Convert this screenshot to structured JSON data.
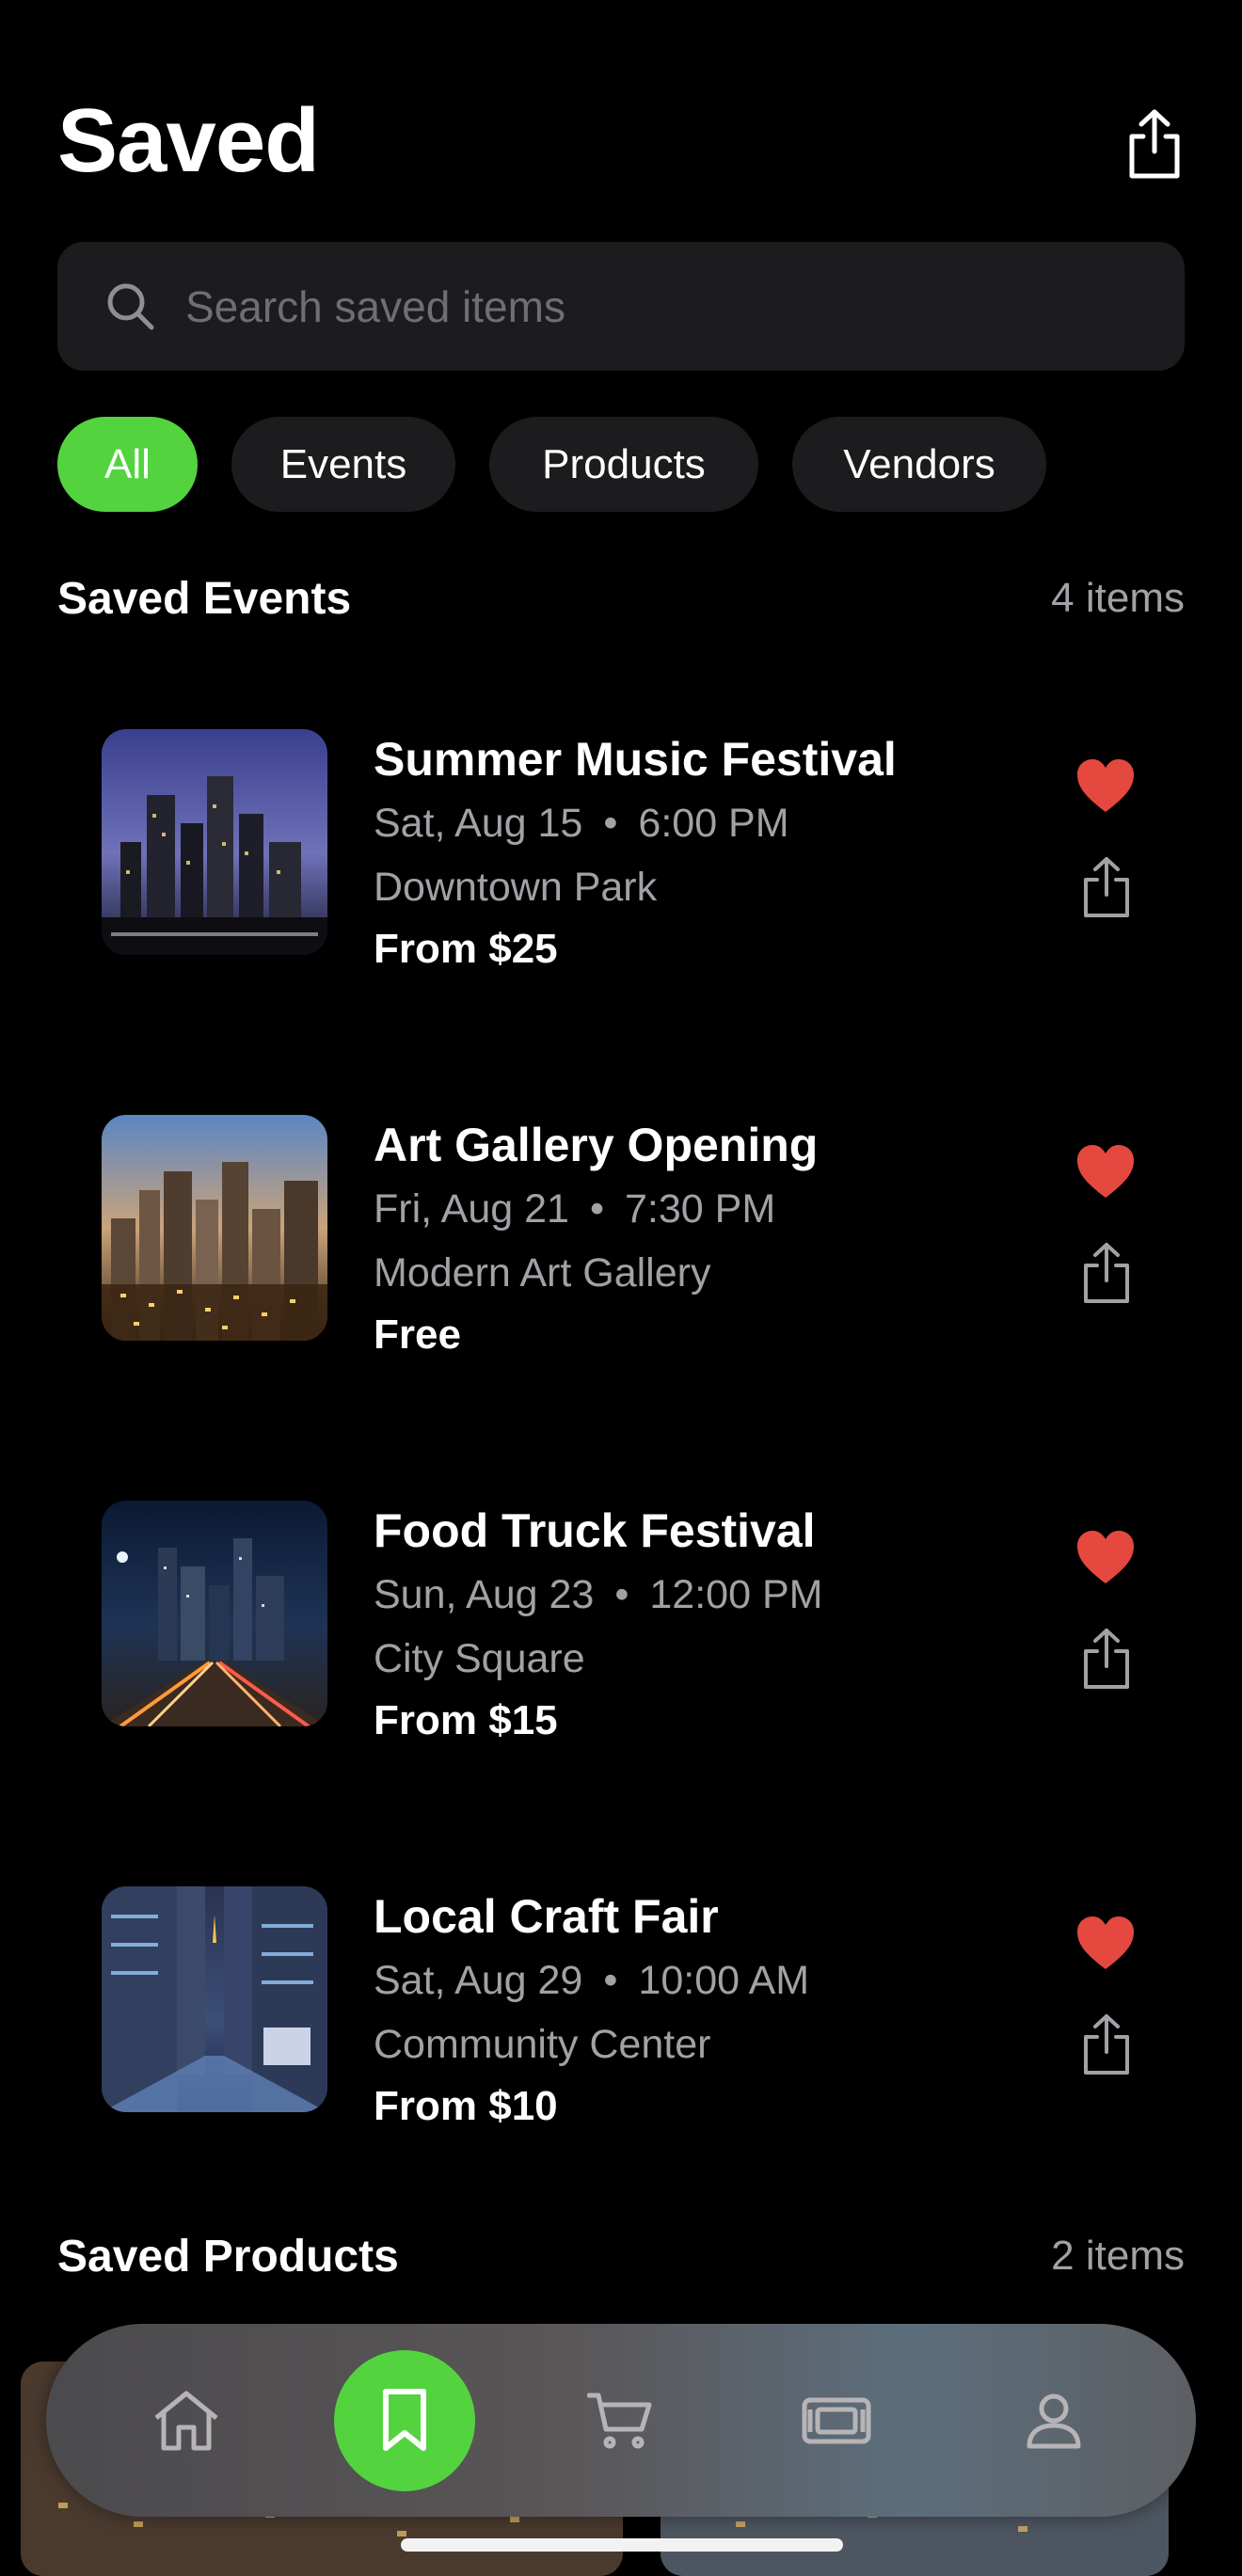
{
  "header": {
    "title": "Saved",
    "share_icon": "share-icon"
  },
  "search": {
    "placeholder": "Search saved items",
    "icon": "search-icon"
  },
  "filters": [
    {
      "label": "All",
      "active": true
    },
    {
      "label": "Events",
      "active": false
    },
    {
      "label": "Products",
      "active": false
    },
    {
      "label": "Vendors",
      "active": false
    }
  ],
  "events_section": {
    "title": "Saved Events",
    "count": "4 items"
  },
  "events": [
    {
      "title": "Summer Music Festival",
      "day": "Sat, Aug 15",
      "time": "6:00 PM",
      "location": "Downtown Park",
      "price": "From $25"
    },
    {
      "title": "Art Gallery Opening",
      "day": "Fri, Aug 21",
      "time": "7:30 PM",
      "location": "Modern Art Gallery",
      "price": "Free"
    },
    {
      "title": "Food Truck Festival",
      "day": "Sun, Aug 23",
      "time": "12:00 PM",
      "location": "City Square",
      "price": "From $15"
    },
    {
      "title": "Local Craft Fair",
      "day": "Sat, Aug 29",
      "time": "10:00 AM",
      "location": "Community Center",
      "price": "From $10"
    }
  ],
  "date_separator": "•",
  "products_section": {
    "title": "Saved Products",
    "count": "2 items"
  },
  "tabbar": {
    "tabs": [
      "home-icon",
      "bookmark-icon",
      "cart-icon",
      "ticket-icon",
      "profile-icon"
    ],
    "active": "bookmark-icon"
  },
  "colors": {
    "accent": "#53d43f",
    "heart": "#e5483f",
    "background": "#000000",
    "surface": "#1c1c1e",
    "secondary_text": "#a1a1a6"
  }
}
